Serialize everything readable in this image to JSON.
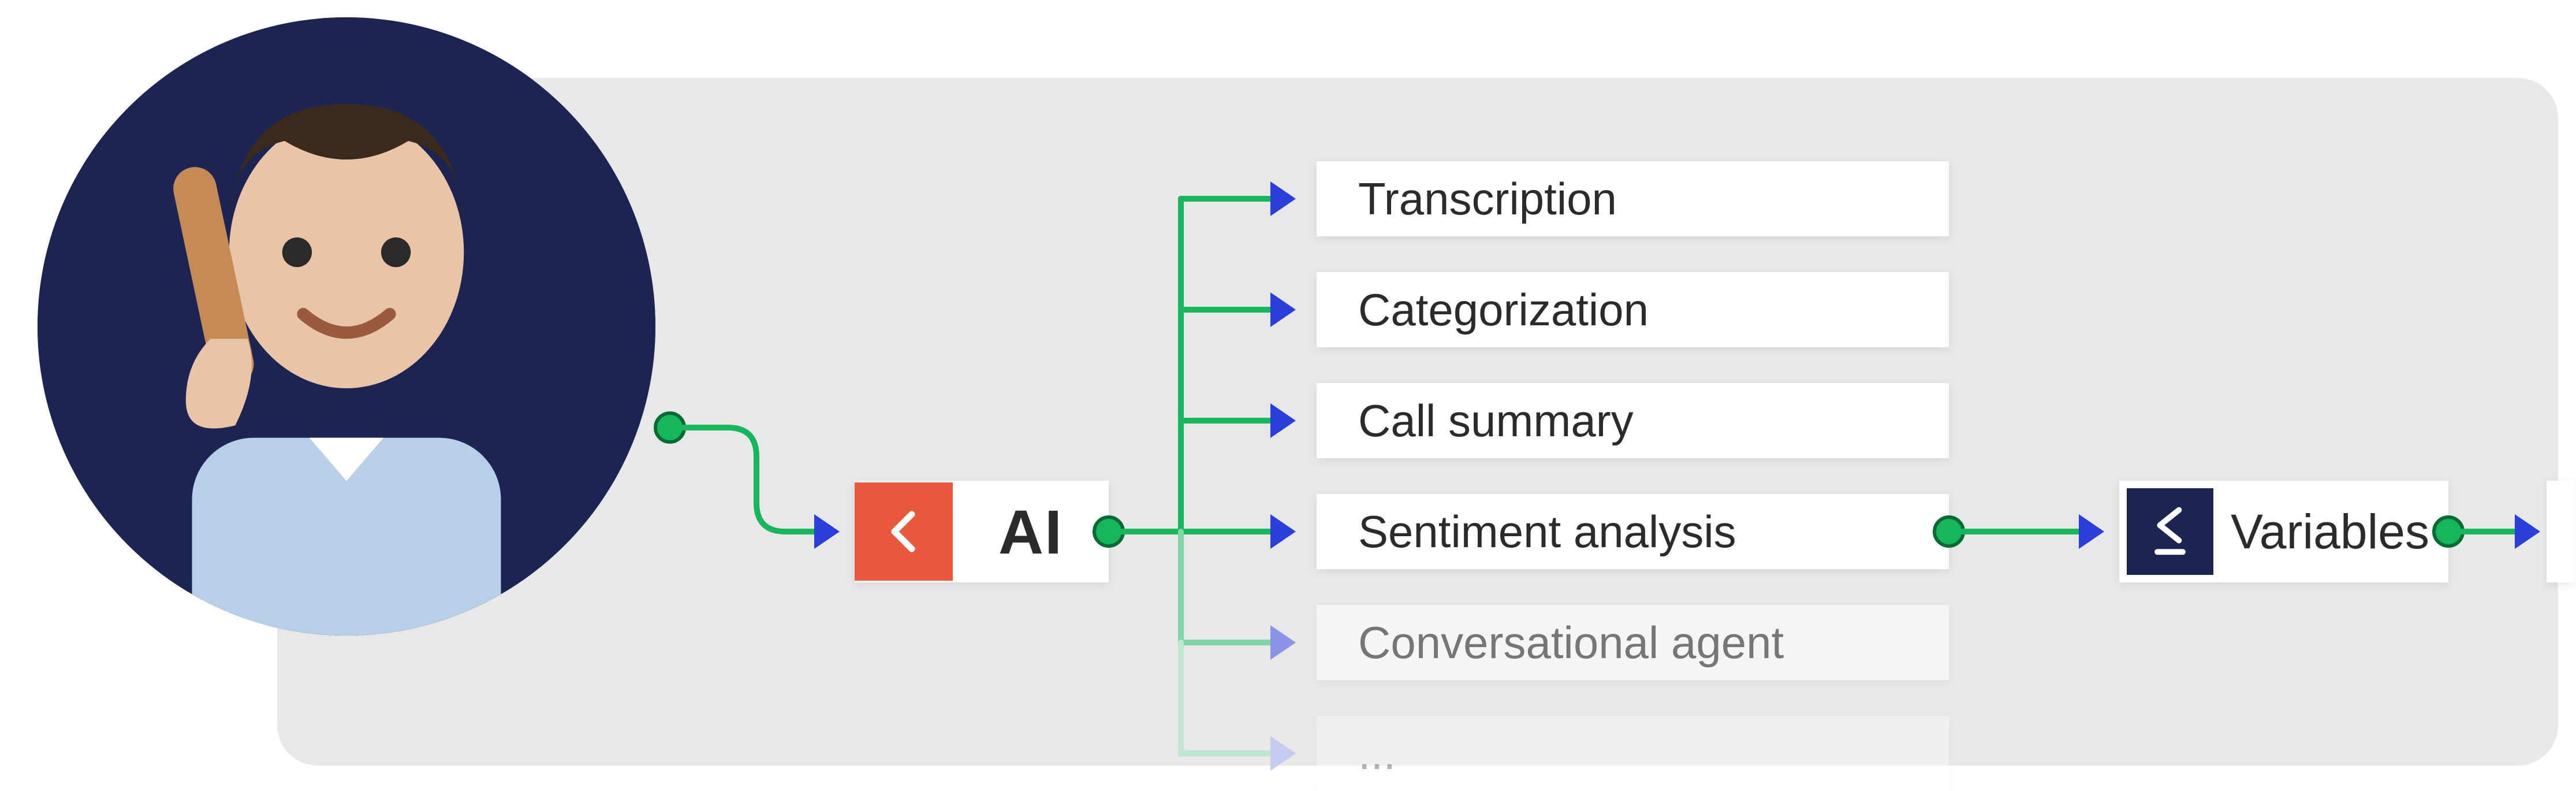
{
  "diagram_type": "flow",
  "colors": {
    "panel_bg": "#e8e8e8",
    "avatar_bg": "#1b2452",
    "connector_green": "#15b65c",
    "connector_green_border": "#0a6a36",
    "arrow_blue": "#2a3fd9",
    "ai_icon_bg": "#e9573d",
    "vars_icon_bg": "#1b2452"
  },
  "input_node": {
    "description": "Person on phone call"
  },
  "ai_node": {
    "label": "AI",
    "glyph": "<"
  },
  "features": [
    {
      "label": "Transcription",
      "faded": 0
    },
    {
      "label": "Categorization",
      "faded": 0
    },
    {
      "label": "Call summary",
      "faded": 0
    },
    {
      "label": "Sentiment analysis",
      "faded": 0
    },
    {
      "label": "Conversational agent",
      "faded": 1
    },
    {
      "label": "...",
      "faded": 2
    }
  ],
  "variables_node": {
    "label": "Variables",
    "glyph": "≤"
  }
}
